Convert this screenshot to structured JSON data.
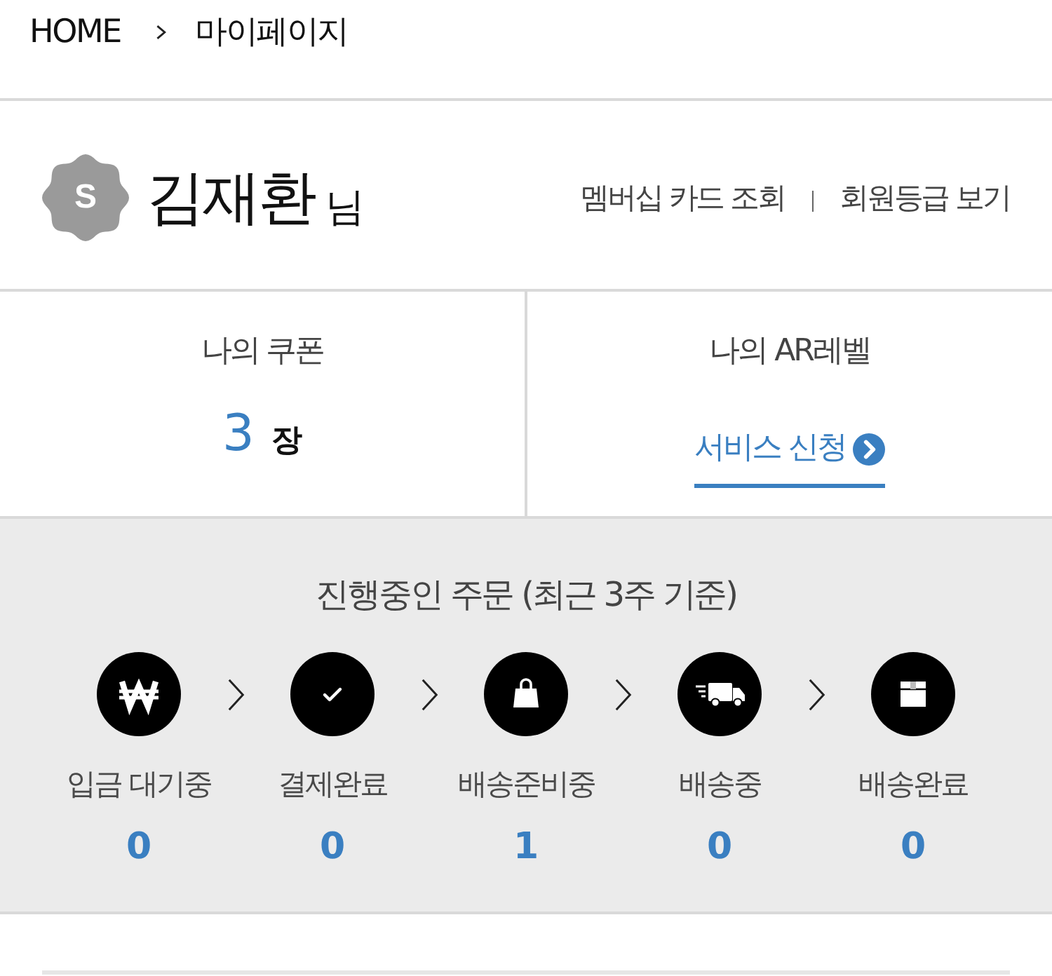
{
  "breadcrumb": [
    {
      "label": "HOME"
    },
    {
      "label": "마이페이지"
    }
  ],
  "profile": {
    "initial": "S",
    "name": "김재환",
    "suffix": "님",
    "links": [
      {
        "label": "멤버십 카드 조회"
      },
      {
        "label": "회원등급 보기"
      }
    ]
  },
  "summary": [
    {
      "kind": "count",
      "title": "나의 쿠폰",
      "value": "3",
      "unit": "장"
    },
    {
      "kind": "link",
      "title": "나의 AR레벨",
      "link": "서비스 신청"
    }
  ],
  "orders": {
    "title": "진행중인 주문 (최근 3주 기준)",
    "steps": [
      {
        "kind": "won",
        "label": "입금 대기중",
        "count": "0"
      },
      {
        "kind": "check",
        "label": "결제완료",
        "count": "0"
      },
      {
        "kind": "bag",
        "label": "배송준비중",
        "count": "1"
      },
      {
        "kind": "truck",
        "label": "배송중",
        "count": "0"
      },
      {
        "kind": "box",
        "label": "배송완료",
        "count": "0"
      }
    ]
  }
}
